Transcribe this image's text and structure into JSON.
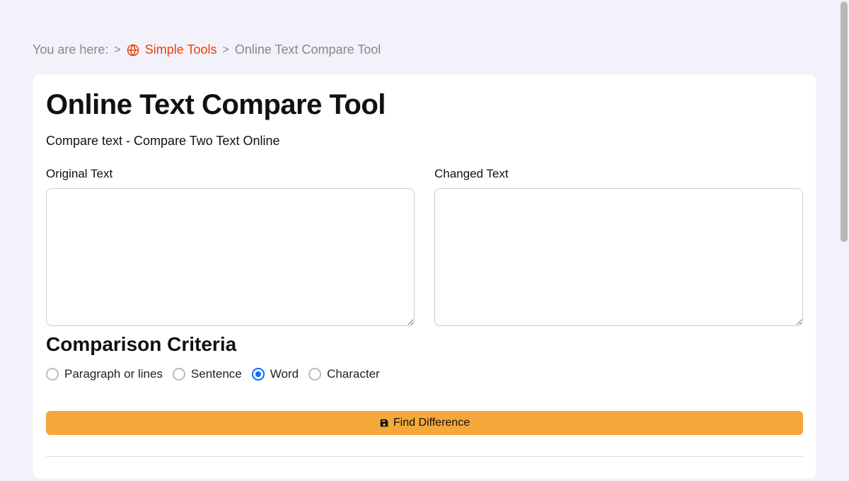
{
  "breadcrumb": {
    "prefix": "You are here:",
    "link_label": "Simple Tools",
    "current": "Online Text Compare Tool"
  },
  "page": {
    "title": "Online Text Compare Tool",
    "subtitle": "Compare text - Compare Two Text Online"
  },
  "inputs": {
    "original_label": "Original Text",
    "changed_label": "Changed Text",
    "original_value": "",
    "changed_value": ""
  },
  "criteria": {
    "title": "Comparison Criteria",
    "options": {
      "paragraph": "Paragraph or lines",
      "sentence": "Sentence",
      "word": "Word",
      "character": "Character"
    },
    "selected": "word"
  },
  "button": {
    "find_difference": "Find Difference"
  }
}
